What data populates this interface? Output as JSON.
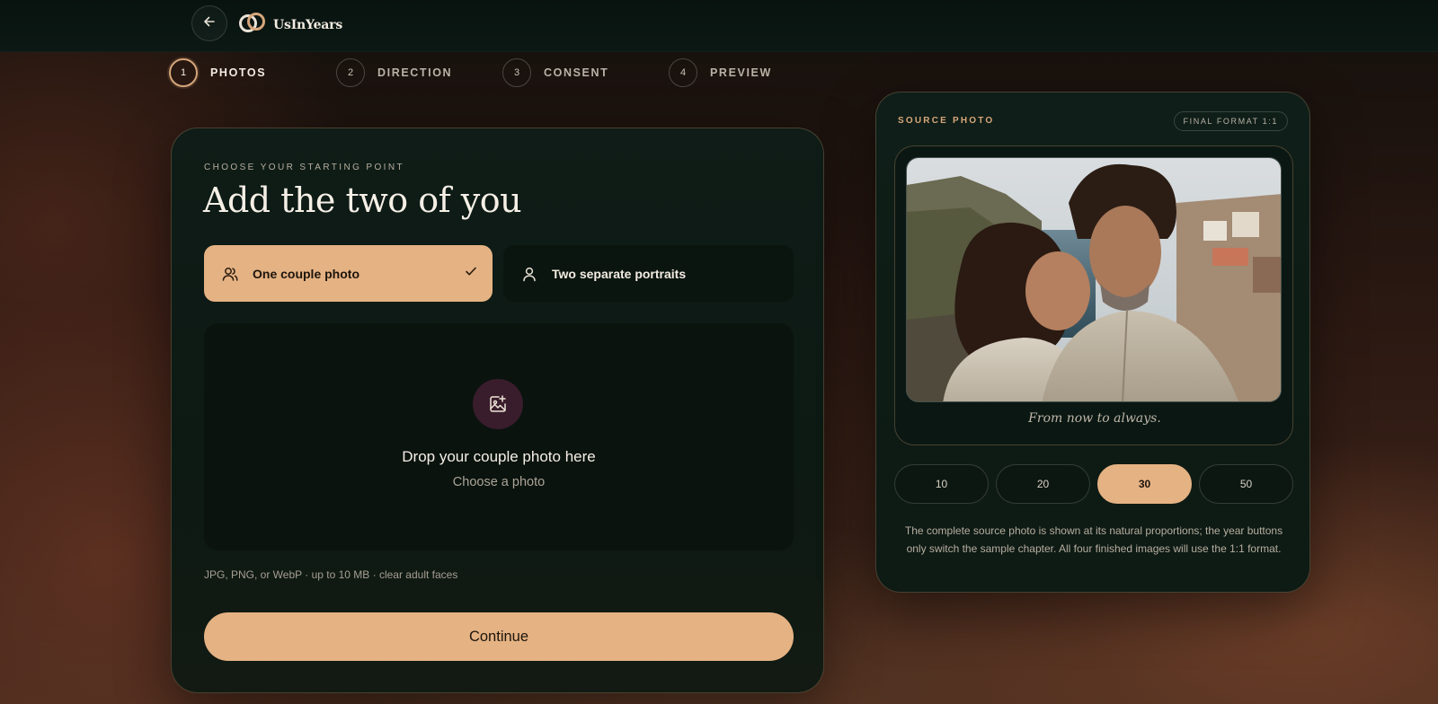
{
  "app": {
    "name": "UsInYears"
  },
  "stepper": [
    {
      "number": "1",
      "label": "PHOTOS",
      "active": true
    },
    {
      "number": "2",
      "label": "DIRECTION",
      "active": false
    },
    {
      "number": "3",
      "label": "CONSENT",
      "active": false
    },
    {
      "number": "4",
      "label": "PREVIEW",
      "active": false
    }
  ],
  "main": {
    "eyebrow": "CHOOSE YOUR STARTING POINT",
    "headline": "Add the two of you",
    "options": [
      {
        "label": "One couple photo",
        "icon": "users-icon",
        "selected": true
      },
      {
        "label": "Two separate portraits",
        "icon": "user-icon",
        "selected": false
      }
    ],
    "dropzone": {
      "icon": "image-plus-icon",
      "title": "Drop your couple photo here",
      "subtitle": "Choose a photo"
    },
    "hint": "JPG, PNG, or WebP · up to 10 MB · clear adult faces",
    "continue_label": "Continue"
  },
  "side": {
    "label": "SOURCE PHOTO",
    "format_badge": "FINAL FORMAT 1:1",
    "caption": "From now to always.",
    "years": [
      {
        "label": "10",
        "active": false
      },
      {
        "label": "20",
        "active": false
      },
      {
        "label": "30",
        "active": true
      },
      {
        "label": "50",
        "active": false
      }
    ],
    "note": "The complete source photo is shown at its natural proportions; the year buttons only switch the sample chapter. All four finished images will use the 1:1 format."
  },
  "colors": {
    "accent": "#e5b283",
    "accent_border": "#d6a67a",
    "card_bg": "#0f1c17",
    "icon_bubble": "#3a1d2c"
  }
}
